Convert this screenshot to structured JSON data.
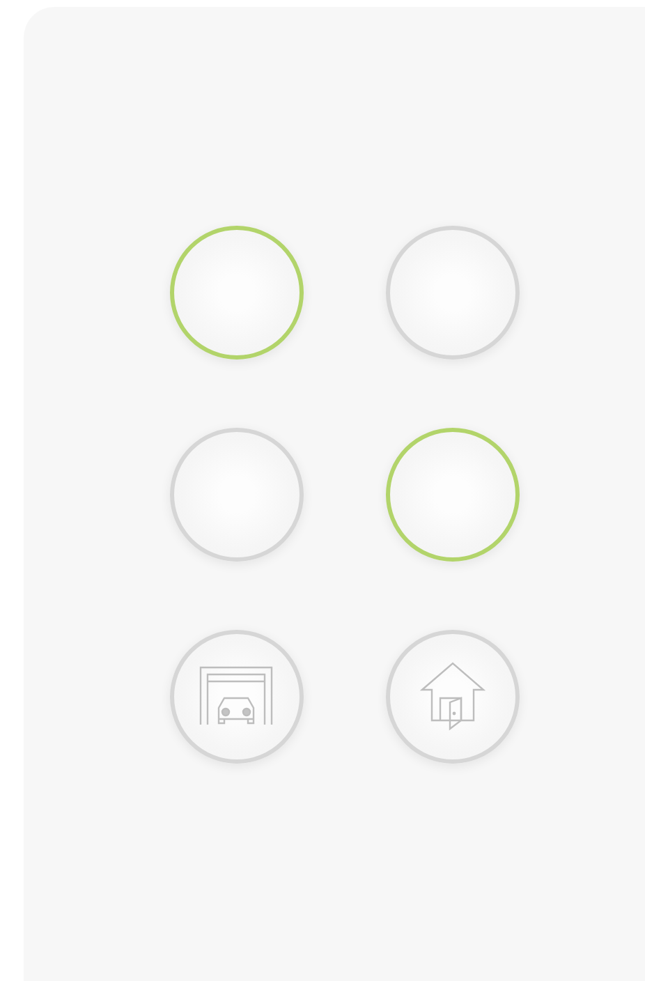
{
  "switch_buttons": [
    {
      "kind": "plain",
      "on": true
    },
    {
      "kind": "plain",
      "on": false
    },
    {
      "kind": "plain",
      "on": false
    },
    {
      "kind": "plain",
      "on": true
    },
    {
      "kind": "garage",
      "on": false
    },
    {
      "kind": "house",
      "on": false
    }
  ]
}
